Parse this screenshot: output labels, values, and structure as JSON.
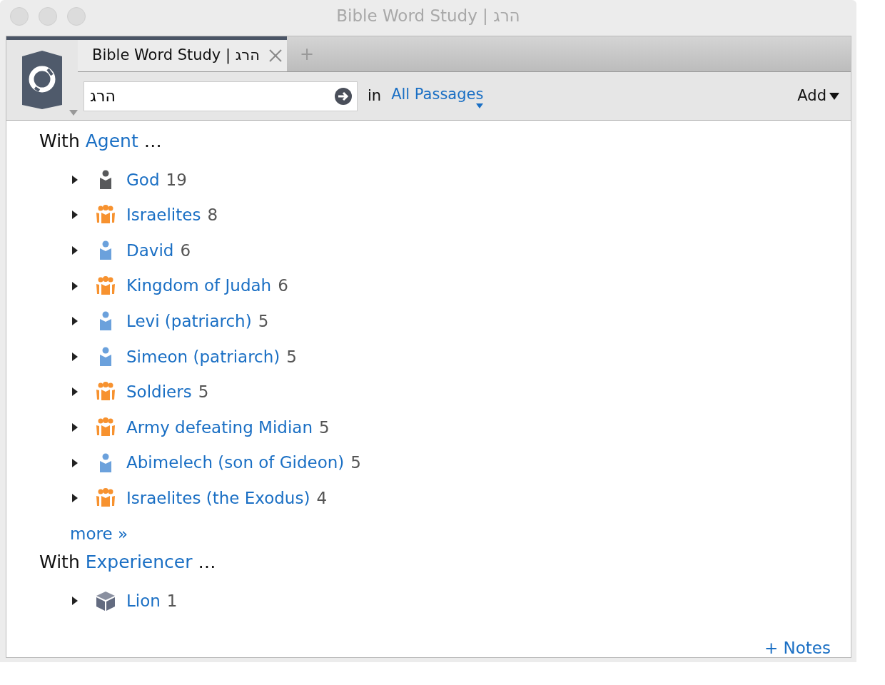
{
  "window": {
    "title": "Bible Word Study | הרג"
  },
  "tabs": [
    {
      "label": "Bible Word Study | הרג",
      "selected": true
    }
  ],
  "new_tab": "+",
  "search": {
    "value": "הרג"
  },
  "scope_label": "in",
  "scope": "All Passages",
  "add_menu": "Add",
  "sections": [
    {
      "prefix": "With",
      "role": "Agent",
      "ellipsis": "…",
      "more": "more »",
      "items": [
        {
          "name": "God",
          "count": "19",
          "kind": "person",
          "color": "#58595b",
          "expanded": false
        },
        {
          "name": "Israelites",
          "count": "8",
          "kind": "group",
          "color": "#f7922f",
          "expanded": false
        },
        {
          "name": "David",
          "count": "6",
          "kind": "person",
          "color": "#6ba1dc",
          "expanded": false
        },
        {
          "name": "Kingdom of Judah",
          "count": "6",
          "kind": "group",
          "color": "#f7922f",
          "expanded": false
        },
        {
          "name": "Levi (patriarch)",
          "count": "5",
          "kind": "person",
          "color": "#6ba1dc",
          "expanded": false
        },
        {
          "name": "Simeon (patriarch)",
          "count": "5",
          "kind": "person",
          "color": "#6ba1dc",
          "expanded": false
        },
        {
          "name": "Soldiers",
          "count": "5",
          "kind": "group",
          "color": "#f7922f",
          "expanded": false
        },
        {
          "name": "Army defeating Midian",
          "count": "5",
          "kind": "group",
          "color": "#f7922f",
          "expanded": false
        },
        {
          "name": "Abimelech (son of Gideon)",
          "count": "5",
          "kind": "person",
          "color": "#6ba1dc",
          "expanded": false
        },
        {
          "name": "Israelites (the Exodus)",
          "count": "4",
          "kind": "group",
          "color": "#f7922f",
          "expanded": false
        }
      ]
    },
    {
      "prefix": "With",
      "role": "Experiencer",
      "ellipsis": "…",
      "items": [
        {
          "name": "Lion",
          "count": "1",
          "kind": "thing",
          "color": "#636b80",
          "expanded": false
        }
      ]
    }
  ],
  "notes_link": "+ Notes"
}
